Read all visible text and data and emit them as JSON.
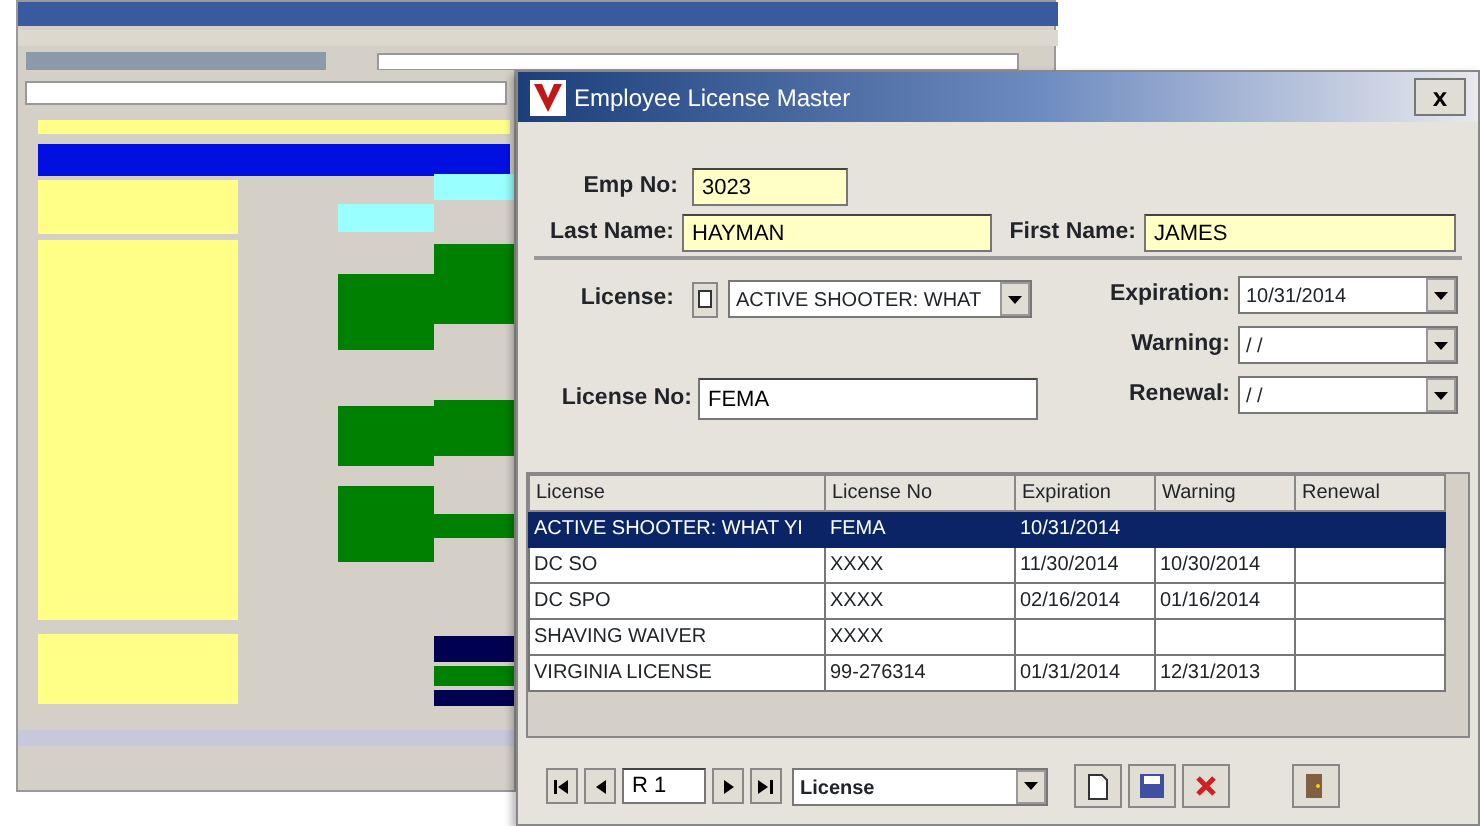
{
  "dialog": {
    "title": "Employee License Master",
    "close": "x"
  },
  "emp_no": {
    "label": "Emp No:",
    "value": "3023"
  },
  "last_name": {
    "label": "Last Name:",
    "value": "HAYMAN"
  },
  "first_name": {
    "label": "First Name:",
    "value": "JAMES"
  },
  "license": {
    "label": "License:",
    "value": "ACTIVE SHOOTER: WHAT"
  },
  "license_no": {
    "label": "License No:",
    "value": "FEMA"
  },
  "dates": [
    {
      "label": "Expiration:",
      "value": "10/31/2014"
    },
    {
      "label": "Warning:",
      "value": "/ /"
    },
    {
      "label": "Renewal:",
      "value": "/ /"
    }
  ],
  "table": {
    "columns": [
      "License",
      "License No",
      "Expiration",
      "Warning",
      "Renewal"
    ],
    "rows": [
      {
        "cells": [
          "ACTIVE SHOOTER: WHAT YI",
          "FEMA",
          "10/31/2014",
          "",
          ""
        ],
        "selected": true
      },
      {
        "cells": [
          "DC SO",
          "XXXX",
          "11/30/2014",
          "10/30/2014",
          ""
        ],
        "selected": false
      },
      {
        "cells": [
          "DC SPO",
          "XXXX",
          "02/16/2014",
          "01/16/2014",
          ""
        ],
        "selected": false
      },
      {
        "cells": [
          "SHAVING WAIVER",
          "XXXX",
          "",
          "",
          ""
        ],
        "selected": false
      },
      {
        "cells": [
          "VIRGINIA LICENSE",
          "99-276314",
          "01/31/2014",
          "12/31/2013",
          ""
        ],
        "selected": false
      }
    ]
  },
  "navigator": {
    "record": "R 1",
    "sort": "License"
  }
}
